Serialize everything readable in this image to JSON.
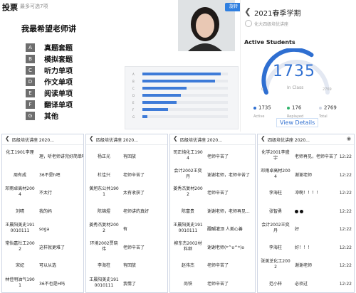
{
  "vote": {
    "title": "投票",
    "subtitle": "最多可选7项",
    "live_button": "旋转",
    "question": "我最希望老师讲",
    "options": [
      {
        "letter": "A",
        "text": "真题套题"
      },
      {
        "letter": "B",
        "text": "模拟套题"
      },
      {
        "letter": "C",
        "text": "听力单项"
      },
      {
        "letter": "D",
        "text": "作文单项"
      },
      {
        "letter": "E",
        "text": "阅读单项"
      },
      {
        "letter": "F",
        "text": "翻译单项"
      },
      {
        "letter": "G",
        "text": "其他"
      }
    ],
    "results": [
      {
        "label": "A",
        "value": 0.92
      },
      {
        "label": "B",
        "value": 0.85
      },
      {
        "label": "C",
        "value": 0.52
      },
      {
        "label": "D",
        "value": 0.45
      },
      {
        "label": "E",
        "value": 0.4
      },
      {
        "label": "F",
        "value": 0.3
      },
      {
        "label": "G",
        "value": 0.06
      }
    ]
  },
  "stats": {
    "title": "2021春季学期",
    "course": "化大四级培优讲座",
    "section_title": "Active Students",
    "count": "1735",
    "count_label": "In Class",
    "gauge_min": "0",
    "gauge_max": "2769",
    "gauge_fill": 0.63,
    "legend": [
      {
        "value": "1735",
        "label": "Active",
        "color": "#2f6fd1"
      },
      {
        "value": "176",
        "label": "Replayed",
        "color": "#2fb36a"
      },
      {
        "value": "2769",
        "label": "Total",
        "color": "#cfd6e4"
      }
    ],
    "view_details": "View Details",
    "colors": {
      "accent": "#2f6fd1",
      "track": "#e3e8f2"
    }
  },
  "chats": [
    {
      "title": "四级培优讲座 2020...",
      "rows": [
        {
          "name": "化工1901李理",
          "message": "理，听老师讲完好简单呀",
          "time": ""
        },
        {
          "name": "周有成",
          "message": "36不是h吧",
          "time": ""
        },
        {
          "name": "邓雨卓高材2004",
          "message": "不太行",
          "time": ""
        },
        {
          "name": "刘晴",
          "message": "我的妈",
          "time": ""
        },
        {
          "name": "王晨阳美史1910010111",
          "message": "soga",
          "time": ""
        },
        {
          "name": "常怡嘉社工2002",
          "message": "这样就更难了",
          "time": ""
        },
        {
          "name": "宋妃",
          "message": "可以从选",
          "time": ""
        },
        {
          "name": "林佳明油气1901",
          "message": "36不也是H吗",
          "time": ""
        }
      ]
    },
    {
      "title": "四级培优讲座 2020...",
      "rows": [
        {
          "name": "杨正光",
          "message": "有回放",
          "time": ""
        },
        {
          "name": "杜佳兴",
          "message": "老师辛苦了",
          "time": ""
        },
        {
          "name": "黄旭东公共1901",
          "message": "太有收获了",
          "time": ""
        },
        {
          "name": "陈锦煜",
          "message": "老师讲的真好",
          "time": ""
        },
        {
          "name": "姜秀杰复材2002",
          "message": "有",
          "time": ""
        },
        {
          "name": "环境2002贾晓伟",
          "message": "老师辛苦了",
          "time": ""
        },
        {
          "name": "李海柱",
          "message": "有回放",
          "time": ""
        },
        {
          "name": "王晨阳美史1910010111",
          "message": "我情了",
          "time": ""
        }
      ]
    },
    {
      "title": "四级培优讲座 2020...",
      "rows": [
        {
          "name": "司正纯化工1904",
          "message": "老师辛苦了",
          "time": ""
        },
        {
          "name": "会计2002王奕丹",
          "message": "谢谢老师，老师辛苦了",
          "time": ""
        },
        {
          "name": "姜秀杰复材2002",
          "message": "老师辛苦了",
          "time": ""
        },
        {
          "name": "陈富贵",
          "message": "谢谢老师，老师再见...",
          "time": ""
        },
        {
          "name": "王晨阳美史1910010111",
          "message": "醍醐灌顶 人美心善",
          "time": ""
        },
        {
          "name": "柳东杰2002材料继",
          "message": "谢谢老师(*^o^*)o",
          "time": ""
        },
        {
          "name": "赵伟杰",
          "message": "老师辛苦了",
          "time": ""
        },
        {
          "name": "尚铁",
          "message": "老师辛苦了",
          "time": ""
        }
      ]
    },
    {
      "title": "四级培优讲座 2020...",
      "rows": [
        {
          "name": "化学2001李盛宇",
          "message": "老师再见，老师辛苦了",
          "time": "12:22"
        },
        {
          "name": "邓雨卓高材2004",
          "message": "谢谢老师",
          "time": "12:22"
        },
        {
          "name": "李海柱",
          "message": "冲啊！！！！",
          "time": "12:22"
        },
        {
          "name": "张智勇",
          "message": "",
          "time": "12:22"
        },
        {
          "name": "会计2002王奕丹",
          "message": "好",
          "time": "12:22"
        },
        {
          "name": "李海柱",
          "message": "好！！！",
          "time": "12:22"
        },
        {
          "name": "张美芝化工2002",
          "message": "谢谢老师",
          "time": "12:22"
        },
        {
          "name": "范小梓",
          "message": "必须过",
          "time": "12:22"
        }
      ]
    }
  ]
}
